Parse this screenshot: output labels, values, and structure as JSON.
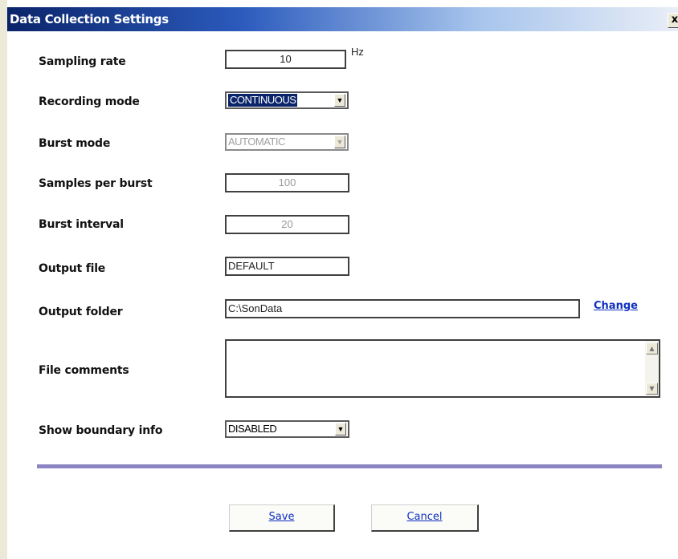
{
  "window": {
    "title": "Data Collection Settings",
    "close_label": "x"
  },
  "fields": {
    "sampling_rate": {
      "label": "Sampling rate",
      "value": "10",
      "unit": "Hz"
    },
    "recording_mode": {
      "label": "Recording mode",
      "value": "CONTINUOUS"
    },
    "burst_mode": {
      "label": "Burst mode",
      "value": "AUTOMATIC"
    },
    "samples_per_burst": {
      "label": "Samples per burst",
      "value": "100"
    },
    "burst_interval": {
      "label": "Burst interval",
      "value": "20"
    },
    "output_file": {
      "label": "Output file",
      "value": "DEFAULT"
    },
    "output_folder": {
      "label": "Output folder",
      "value": "C:\\SonData",
      "change_label": "Change"
    },
    "file_comments": {
      "label": "File comments",
      "value": ""
    },
    "show_boundary_info": {
      "label": "Show boundary info",
      "value": "DISABLED"
    }
  },
  "buttons": {
    "save": "Save",
    "cancel": "Cancel"
  },
  "colors": {
    "title_bar": "#0a246a",
    "link": "#1030c0",
    "divider": "#8b85c4",
    "selection": "#0a246a"
  },
  "icons": {
    "close": "close-icon",
    "dropdown": "chevron-down-icon",
    "scroll_up": "arrow-up-icon",
    "scroll_down": "arrow-down-icon"
  }
}
